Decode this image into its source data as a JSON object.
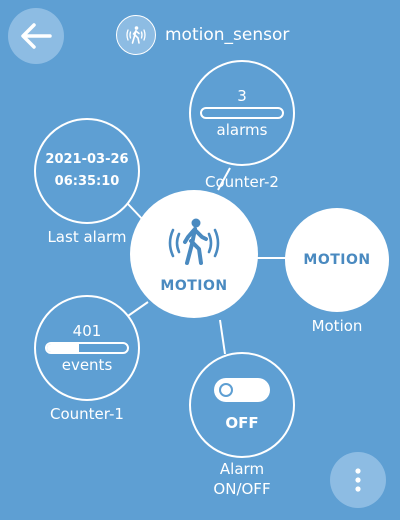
{
  "header": {
    "title": "motion_sensor",
    "back_icon": "arrow-left-icon",
    "device_icon": "walking-person-icon"
  },
  "center": {
    "state_label": "MOTION",
    "icon": "walking-person-icon"
  },
  "counter2": {
    "value": "3",
    "unit": "alarms",
    "fill_fraction": 0.0,
    "label": "Counter-2"
  },
  "last_alarm": {
    "date": "2021-03-26",
    "time": "06:35:10",
    "label": "Last alarm"
  },
  "motion": {
    "state": "MOTION",
    "label": "Motion"
  },
  "counter1": {
    "value": "401",
    "unit": "events",
    "fill_fraction": 0.4,
    "label": "Counter-1"
  },
  "alarm_switch": {
    "state": "OFF",
    "label_line1": "Alarm",
    "label_line2": "ON/OFF"
  },
  "menu": {
    "icon": "more-vertical-icon"
  },
  "colors": {
    "background": "#5e9fd3",
    "accent_text": "#4a8ac0",
    "button_bg": "#8dbce3"
  }
}
